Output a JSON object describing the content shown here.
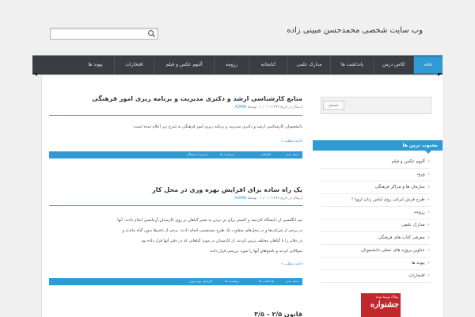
{
  "site": {
    "title": "وب سایت شخصی محمدحسن مبینی زاده"
  },
  "nav": {
    "items": [
      "خانه",
      "کلاس درس",
      "یادداشت ها",
      "مدارک علمی",
      "کتابخانه",
      "رزومه",
      "آلبوم عکس و فیلم",
      "افتخارات",
      "پیوند ها"
    ],
    "active_color": "#2f9ad3"
  },
  "posts": [
    {
      "title": "منابع کارشناسی ارشد و دکتری مدیریت و برنامه ریزی امور فرهنگی",
      "meta_prefix": "ارسال در تاریخ",
      "meta_by": "توسط",
      "author": "ADMIN",
      "text": "دانشجویان کارشناسی ارشد و دکتری مدیریت و برنامه ریزی امور فرهنگی به شرح زیر اعلام شده است:",
      "read_more": "ادامه مطلب »",
      "bar_items": [
        "دسته بندی",
        "برچسب ها",
        "کتابخانه",
        "مدیریت فرهنگی"
      ]
    },
    {
      "title": "یک راه ساده برای افزایش بهره وری در محل کار",
      "meta_prefix": "ارسال در تاریخ",
      "meta_by": "توسط",
      "author": "ADMIN",
      "lines": [
        "تیم انگلیسی از دانشگاه کاردیف و اکستر برای پی بردن به تغییر گیاهان بر روی کارمندان آزمایشی انجام دادند: آنها",
        "در برخی از شرکت‌ها و در محل‌های متفاوت یک طرح مستقیمی انجام دادند. برخی از دفترها بدون گیاه ماندند و",
        "در دفاتر را با گیاهان مختلف تزیین کردند. از کارمندان در مورد گیاهانی که در دفتر آنها قرار داده بود",
        "سوالاتی کردند و پاسخ‌های آنها را مورد بررسی قرار دادند"
      ],
      "read_more": "ادامه مطلب »",
      "bar_items": [
        "دسته بندی",
        "یادداشت ها",
        "برچسب ها",
        "افزایش بهره وری"
      ]
    }
  ],
  "third_post": {
    "title": "قانون ۲/۵ – ۳/۵"
  },
  "sidebar": {
    "search_button": "جستجو",
    "widget_title": "محبوب ترین ها",
    "items": [
      "آلبوم عکس و فیلم",
      "ورود",
      "سازمان ها و مراکز فرهنگی",
      "طرح فرش ایرانی روی لباس زنان اروپا !",
      "رزومه",
      "مدارک علمی",
      "معرفی کتاب های فرهنگی",
      "عناوین پروژه های عملی دانشجویان",
      "پیوند ها",
      "افتخارات"
    ]
  },
  "banner": {
    "small_text": "وبلاگ نویسا توجه",
    "big_text": "جشنواره"
  }
}
